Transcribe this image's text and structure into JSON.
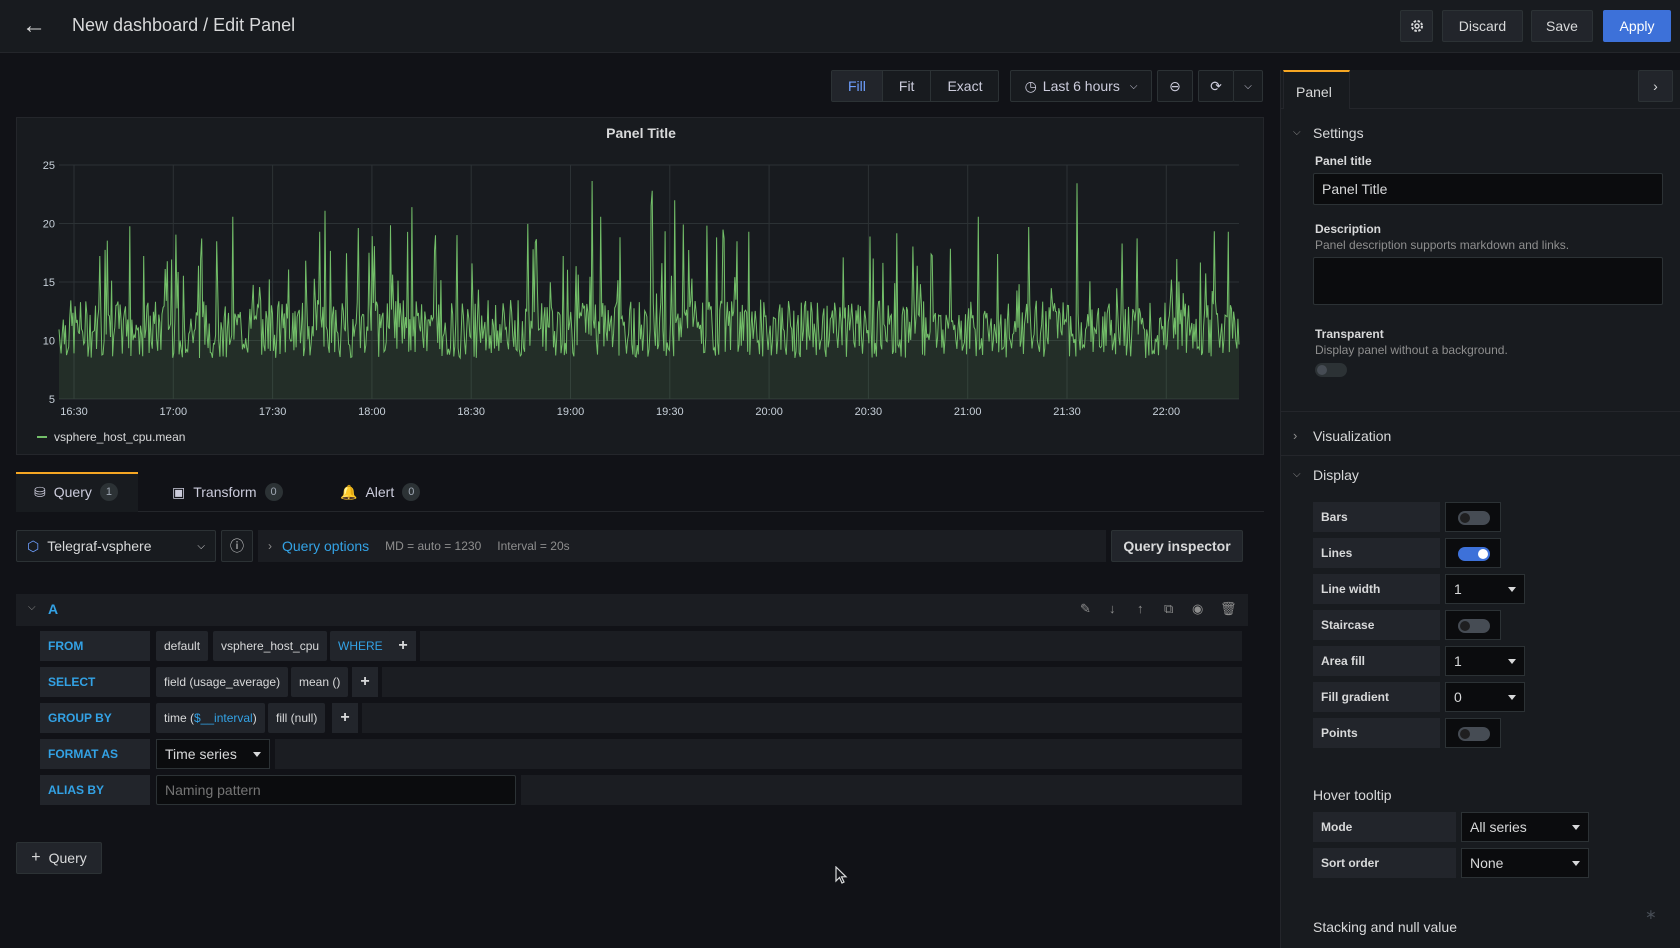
{
  "header": {
    "title": "New dashboard / Edit Panel",
    "discard": "Discard",
    "save": "Save",
    "apply": "Apply"
  },
  "toolbar": {
    "modes": [
      "Fill",
      "Fit",
      "Exact"
    ],
    "time_range": "Last 6 hours"
  },
  "panel": {
    "title": "Panel Title",
    "legend": "vsphere_host_cpu.mean"
  },
  "chart_data": {
    "type": "line",
    "title": "Panel Title",
    "x_ticks": [
      "16:30",
      "17:00",
      "17:30",
      "18:00",
      "18:30",
      "19:00",
      "19:30",
      "20:00",
      "20:30",
      "21:00",
      "21:30",
      "22:00"
    ],
    "y_ticks": [
      "25",
      "20",
      "15",
      "10",
      "5"
    ],
    "ylim": [
      5,
      25
    ],
    "series": [
      {
        "name": "vsphere_host_cpu.mean",
        "color": "#73bf69",
        "baseline": 11,
        "spike_max": 24
      }
    ],
    "grid": true,
    "legend_placement": "bottom-left"
  },
  "tabs": [
    {
      "label": "Query",
      "count": "1"
    },
    {
      "label": "Transform",
      "count": "0"
    },
    {
      "label": "Alert",
      "count": "0"
    }
  ],
  "query": {
    "datasource": "Telegraf-vsphere",
    "options_label": "Query options",
    "md": "MD = auto = 1230",
    "interval": "Interval = 20s",
    "inspector": "Query inspector",
    "ref": "A",
    "from_kw": "FROM",
    "from_db": "default",
    "from_meas": "vsphere_host_cpu",
    "where_kw": "WHERE",
    "select_kw": "SELECT",
    "select_field": "field (usage_average)",
    "select_fn": "mean ()",
    "group_kw": "GROUP BY",
    "group_time_a": "time (",
    "group_time_b": "$__interval",
    "group_time_c": ")",
    "group_fill": "fill (null)",
    "format_kw": "FORMAT AS",
    "format_val": "Time series",
    "alias_kw": "ALIAS BY",
    "alias_placeholder": "Naming pattern",
    "add_query": "Query"
  },
  "options": {
    "tab": "Panel",
    "settings": "Settings",
    "panel_title_label": "Panel title",
    "panel_title_value": "Panel Title",
    "description_label": "Description",
    "description_help": "Panel description supports markdown and links.",
    "transparent_label": "Transparent",
    "transparent_help": "Display panel without a background.",
    "visualization": "Visualization",
    "display": "Display",
    "bars": "Bars",
    "lines": "Lines",
    "line_width": "Line width",
    "line_width_val": "1",
    "staircase": "Staircase",
    "area_fill": "Area fill",
    "area_fill_val": "1",
    "fill_gradient": "Fill gradient",
    "fill_gradient_val": "0",
    "points": "Points",
    "hover_tooltip": "Hover tooltip",
    "mode": "Mode",
    "mode_val": "All series",
    "sort_order": "Sort order",
    "sort_val": "None",
    "stacking": "Stacking and null value"
  }
}
